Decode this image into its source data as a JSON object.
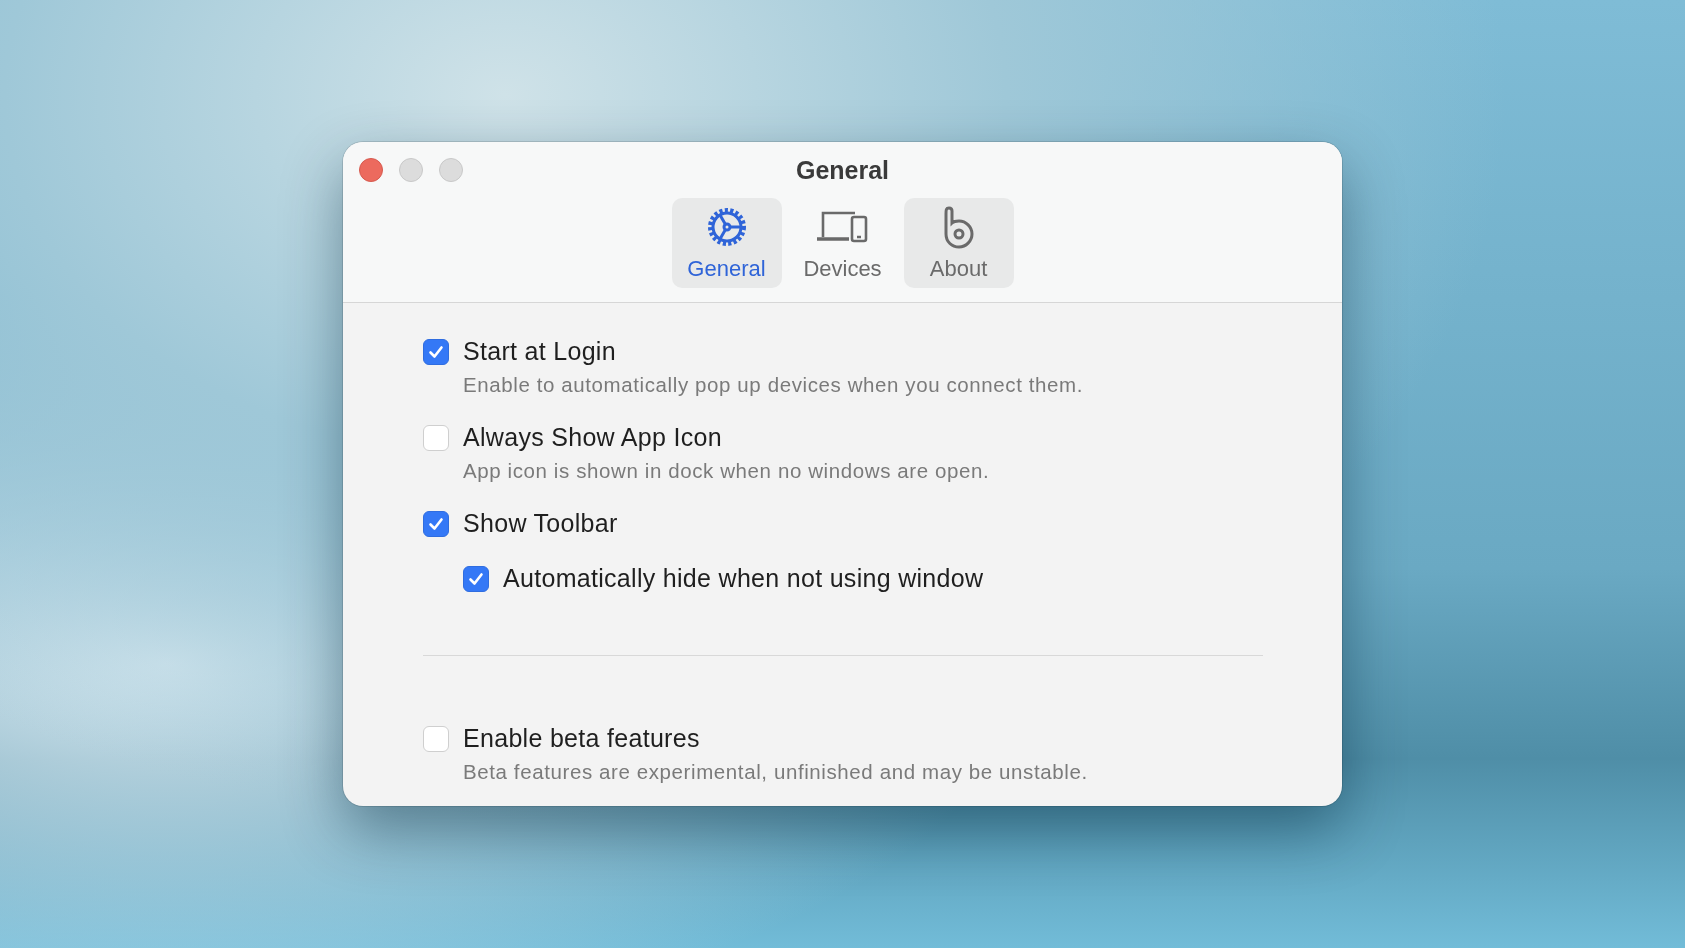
{
  "window": {
    "title": "General"
  },
  "tabs": [
    {
      "label": "General",
      "selected": true,
      "highlighted": true
    },
    {
      "label": "Devices",
      "selected": false,
      "highlighted": false
    },
    {
      "label": "About",
      "selected": false,
      "highlighted": true
    }
  ],
  "options": [
    {
      "label": "Start at Login",
      "description": "Enable to automatically pop up devices when you connect them.",
      "checked": true
    },
    {
      "label": "Always Show App Icon",
      "description": "App icon is shown in dock when no windows are open.",
      "checked": false
    },
    {
      "label": "Show Toolbar",
      "checked": true,
      "children": [
        {
          "label": "Automatically hide when not using window",
          "checked": true
        }
      ]
    }
  ],
  "beta_options": [
    {
      "label": "Enable beta features",
      "description": "Beta features are experimental, unfinished and may be unstable.",
      "checked": false
    }
  ]
}
